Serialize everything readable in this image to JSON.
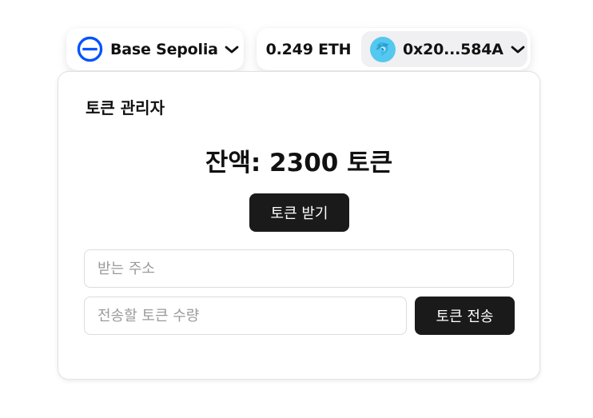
{
  "wallet": {
    "network": {
      "name": "Base Sepolia",
      "logo_icon": "base-network-logo-icon",
      "logo_color": "#0052ff"
    },
    "balance": "0.249 ETH",
    "account": {
      "address": "0x20...584A",
      "avatar_icon": "dolphin-avatar-icon",
      "avatar_emoji": "🐬",
      "avatar_color": "#55c8ef"
    }
  },
  "card": {
    "title": "토큰 관리자",
    "balance_text": "잔액: 2300 토큰",
    "claim_button": "토큰 받기",
    "recipient_input": {
      "placeholder": "받는 주소",
      "value": ""
    },
    "amount_input": {
      "placeholder": "전송할 토큰 수량",
      "value": ""
    },
    "send_button": "토큰 전송"
  }
}
